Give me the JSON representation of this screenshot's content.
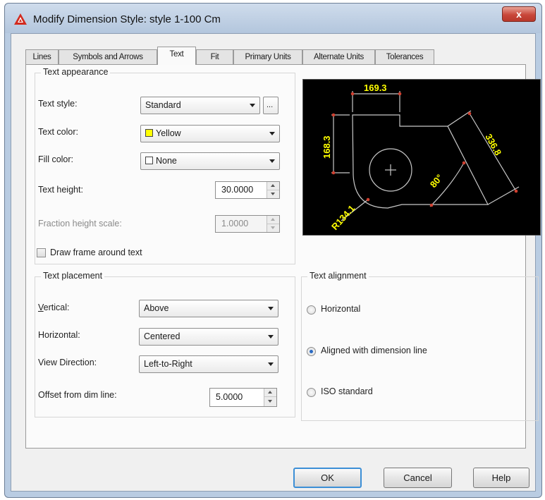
{
  "window": {
    "title": "Modify Dimension Style: style 1-100 Cm",
    "close_label": "x"
  },
  "tabs": [
    {
      "label": "Lines",
      "active": false
    },
    {
      "label": "Symbols and Arrows",
      "active": false
    },
    {
      "label": "Text",
      "active": true
    },
    {
      "label": "Fit",
      "active": false
    },
    {
      "label": "Primary Units",
      "active": false
    },
    {
      "label": "Alternate Units",
      "active": false
    },
    {
      "label": "Tolerances",
      "active": false
    }
  ],
  "text_appearance": {
    "title": "Text appearance",
    "text_style_label": "Text style:",
    "text_style_value": "Standard",
    "browse_label": "...",
    "text_color_label": "Text color:",
    "text_color_value": "Yellow",
    "text_color_swatch": "#ffff00",
    "fill_color_label": "Fill color:",
    "fill_color_value": "None",
    "fill_color_swatch": "#ffffff",
    "text_height_label": "Text height:",
    "text_height_value": "30.0000",
    "fraction_height_label": "Fraction height scale:",
    "fraction_height_value": "1.0000",
    "draw_frame_label": "Draw frame around text",
    "draw_frame_checked": false
  },
  "text_placement": {
    "title": "Text placement",
    "vertical_label": "Vertical:",
    "vertical_value": "Above",
    "horizontal_label": "Horizontal:",
    "horizontal_value": "Centered",
    "view_direction_label": "View Direction:",
    "view_direction_value": "Left-to-Right",
    "offset_label": "Offset from dim line:",
    "offset_value": "5.0000"
  },
  "text_alignment": {
    "title": "Text alignment",
    "options": [
      {
        "label": "Horizontal",
        "selected": false
      },
      {
        "label": "Aligned with dimension line",
        "selected": true
      },
      {
        "label": "ISO standard",
        "selected": false
      }
    ]
  },
  "preview": {
    "dim_top": "169.3",
    "dim_left": "168.3",
    "dim_diag": "336.8",
    "dim_angle": "80°",
    "dim_radius": "R134.1"
  },
  "buttons": {
    "ok": "OK",
    "cancel": "Cancel",
    "help": "Help"
  },
  "colors": {
    "preview_background": "#000000",
    "preview_lines": "#c8c8c8",
    "preview_text": "#ffff00",
    "preview_markers": "#d04030",
    "close_button": "#c9473a"
  }
}
